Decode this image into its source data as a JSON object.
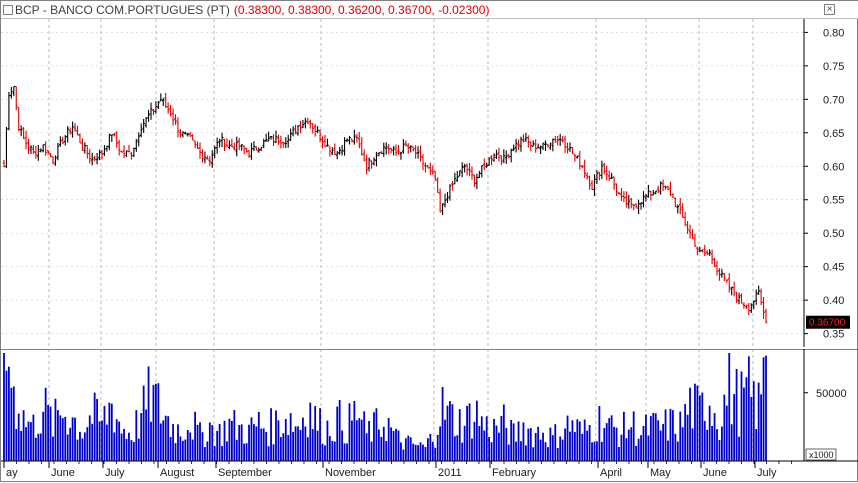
{
  "window": {
    "symbol_title": "BCP - BANCO COM.PORTUGUES (PT)",
    "quote": "(0.38300, 0.38300, 0.36200, 0.36700, -0.02300)",
    "close_glyph": "×"
  },
  "chart_data": [
    {
      "type": "bar",
      "subtype": "ohlc",
      "title": "BCP - BANCO COM.PORTUGUES (PT)",
      "ylim": [
        0.33,
        0.82
      ],
      "y_ticks": [
        "0.80",
        "0.75",
        "0.70",
        "0.65",
        "0.60",
        "0.55",
        "0.50",
        "0.45",
        "0.40",
        "0.35"
      ],
      "x_tick_labels": [
        "ay",
        "June",
        "July",
        "August",
        "September",
        "November",
        "2011",
        "February",
        "April",
        "May",
        "June",
        "July"
      ],
      "grid": true,
      "up_color": "#000000",
      "down_color": "#e00000",
      "last_value_label": "0.36700",
      "last_value": 0.367,
      "close_series": [
        [
          0,
          0.6
        ],
        [
          2,
          0.71
        ],
        [
          4,
          0.72
        ],
        [
          6,
          0.66
        ],
        [
          8,
          0.64
        ],
        [
          12,
          0.62
        ],
        [
          16,
          0.63
        ],
        [
          20,
          0.61
        ],
        [
          24,
          0.64
        ],
        [
          28,
          0.66
        ],
        [
          32,
          0.63
        ],
        [
          36,
          0.61
        ],
        [
          40,
          0.62
        ],
        [
          44,
          0.65
        ],
        [
          48,
          0.62
        ],
        [
          52,
          0.62
        ],
        [
          56,
          0.66
        ],
        [
          60,
          0.68
        ],
        [
          64,
          0.7
        ],
        [
          68,
          0.68
        ],
        [
          72,
          0.65
        ],
        [
          76,
          0.64
        ],
        [
          80,
          0.62
        ],
        [
          84,
          0.61
        ],
        [
          88,
          0.64
        ],
        [
          92,
          0.63
        ],
        [
          96,
          0.63
        ],
        [
          100,
          0.62
        ],
        [
          104,
          0.63
        ],
        [
          108,
          0.64
        ],
        [
          112,
          0.64
        ],
        [
          116,
          0.64
        ],
        [
          120,
          0.66
        ],
        [
          124,
          0.67
        ],
        [
          128,
          0.65
        ],
        [
          132,
          0.63
        ],
        [
          136,
          0.62
        ],
        [
          140,
          0.64
        ],
        [
          144,
          0.64
        ],
        [
          148,
          0.6
        ],
        [
          152,
          0.62
        ],
        [
          156,
          0.63
        ],
        [
          160,
          0.62
        ],
        [
          164,
          0.63
        ],
        [
          168,
          0.62
        ],
        [
          172,
          0.6
        ],
        [
          176,
          0.58
        ],
        [
          178,
          0.53
        ],
        [
          180,
          0.55
        ],
        [
          184,
          0.58
        ],
        [
          188,
          0.6
        ],
        [
          192,
          0.58
        ],
        [
          196,
          0.6
        ],
        [
          200,
          0.62
        ],
        [
          204,
          0.61
        ],
        [
          208,
          0.63
        ],
        [
          212,
          0.64
        ],
        [
          216,
          0.63
        ],
        [
          220,
          0.63
        ],
        [
          224,
          0.64
        ],
        [
          228,
          0.64
        ],
        [
          232,
          0.62
        ],
        [
          236,
          0.6
        ],
        [
          240,
          0.57
        ],
        [
          244,
          0.6
        ],
        [
          248,
          0.58
        ],
        [
          252,
          0.55
        ],
        [
          256,
          0.54
        ],
        [
          260,
          0.55
        ],
        [
          264,
          0.56
        ],
        [
          268,
          0.57
        ],
        [
          272,
          0.56
        ],
        [
          276,
          0.53
        ],
        [
          280,
          0.5
        ],
        [
          284,
          0.47
        ],
        [
          288,
          0.47
        ],
        [
          292,
          0.44
        ],
        [
          296,
          0.42
        ],
        [
          300,
          0.4
        ],
        [
          304,
          0.39
        ],
        [
          308,
          0.41
        ],
        [
          311,
          0.367
        ]
      ]
    },
    {
      "type": "bar",
      "title": "",
      "y_ticks": [
        "50000"
      ],
      "y_multiplier_label": "x1000",
      "bar_color": "#0000cc",
      "volume_series": [
        [
          0,
          62000
        ],
        [
          2,
          92000
        ],
        [
          4,
          55000
        ],
        [
          6,
          48000
        ],
        [
          8,
          35000
        ],
        [
          12,
          28000
        ],
        [
          16,
          45000
        ],
        [
          20,
          30000
        ],
        [
          24,
          42000
        ],
        [
          28,
          35000
        ],
        [
          32,
          25000
        ],
        [
          36,
          38000
        ],
        [
          40,
          30000
        ],
        [
          44,
          48000
        ],
        [
          48,
          26000
        ],
        [
          52,
          22000
        ],
        [
          56,
          36000
        ],
        [
          60,
          55000
        ],
        [
          64,
          42000
        ],
        [
          68,
          30000
        ],
        [
          72,
          24000
        ],
        [
          76,
          34000
        ],
        [
          80,
          20000
        ],
        [
          84,
          28000
        ],
        [
          88,
          22000
        ],
        [
          92,
          30000
        ],
        [
          96,
          26000
        ],
        [
          100,
          24000
        ],
        [
          104,
          30000
        ],
        [
          108,
          26000
        ],
        [
          112,
          32000
        ],
        [
          116,
          36000
        ],
        [
          120,
          28000
        ],
        [
          124,
          46000
        ],
        [
          128,
          30000
        ],
        [
          132,
          26000
        ],
        [
          136,
          34000
        ],
        [
          140,
          28000
        ],
        [
          144,
          40000
        ],
        [
          148,
          22000
        ],
        [
          152,
          28000
        ],
        [
          156,
          32000
        ],
        [
          160,
          18000
        ],
        [
          164,
          14000
        ],
        [
          168,
          12000
        ],
        [
          172,
          10000
        ],
        [
          176,
          24000
        ],
        [
          178,
          46000
        ],
        [
          180,
          40000
        ],
        [
          184,
          34000
        ],
        [
          188,
          30000
        ],
        [
          192,
          42000
        ],
        [
          196,
          28000
        ],
        [
          200,
          26000
        ],
        [
          204,
          30000
        ],
        [
          208,
          20000
        ],
        [
          212,
          28000
        ],
        [
          216,
          22000
        ],
        [
          220,
          24000
        ],
        [
          224,
          18000
        ],
        [
          228,
          26000
        ],
        [
          232,
          30000
        ],
        [
          236,
          22000
        ],
        [
          240,
          28000
        ],
        [
          244,
          34000
        ],
        [
          248,
          26000
        ],
        [
          252,
          24000
        ],
        [
          256,
          30000
        ],
        [
          260,
          22000
        ],
        [
          264,
          28000
        ],
        [
          268,
          26000
        ],
        [
          272,
          30000
        ],
        [
          276,
          28000
        ],
        [
          280,
          46000
        ],
        [
          284,
          40000
        ],
        [
          288,
          52000
        ],
        [
          292,
          34000
        ],
        [
          296,
          60000
        ],
        [
          300,
          48000
        ],
        [
          304,
          56000
        ],
        [
          308,
          44000
        ],
        [
          311,
          78000
        ]
      ]
    }
  ]
}
